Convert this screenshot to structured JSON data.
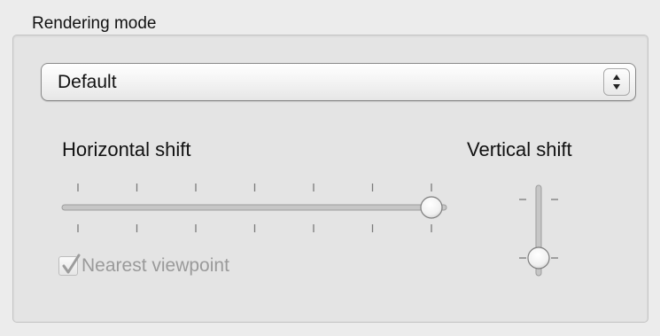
{
  "group": {
    "title": "Rendering mode"
  },
  "rendering_mode_popup": {
    "selected": "Default"
  },
  "horizontal_shift": {
    "label": "Horizontal shift",
    "tick_count": 7,
    "value_fraction": 1.0
  },
  "vertical_shift": {
    "label": "Vertical shift",
    "tick_count": 2,
    "value_fraction": 0.0
  },
  "nearest_viewpoint": {
    "label": "Nearest viewpoint",
    "checked": true,
    "enabled": false
  },
  "icons": {
    "popup_arrows": "up-down-arrows-icon",
    "checkmark": "checkmark-icon"
  },
  "colors": {
    "disabled_text": "#9a9a9a",
    "track": "#c9c9c9"
  }
}
